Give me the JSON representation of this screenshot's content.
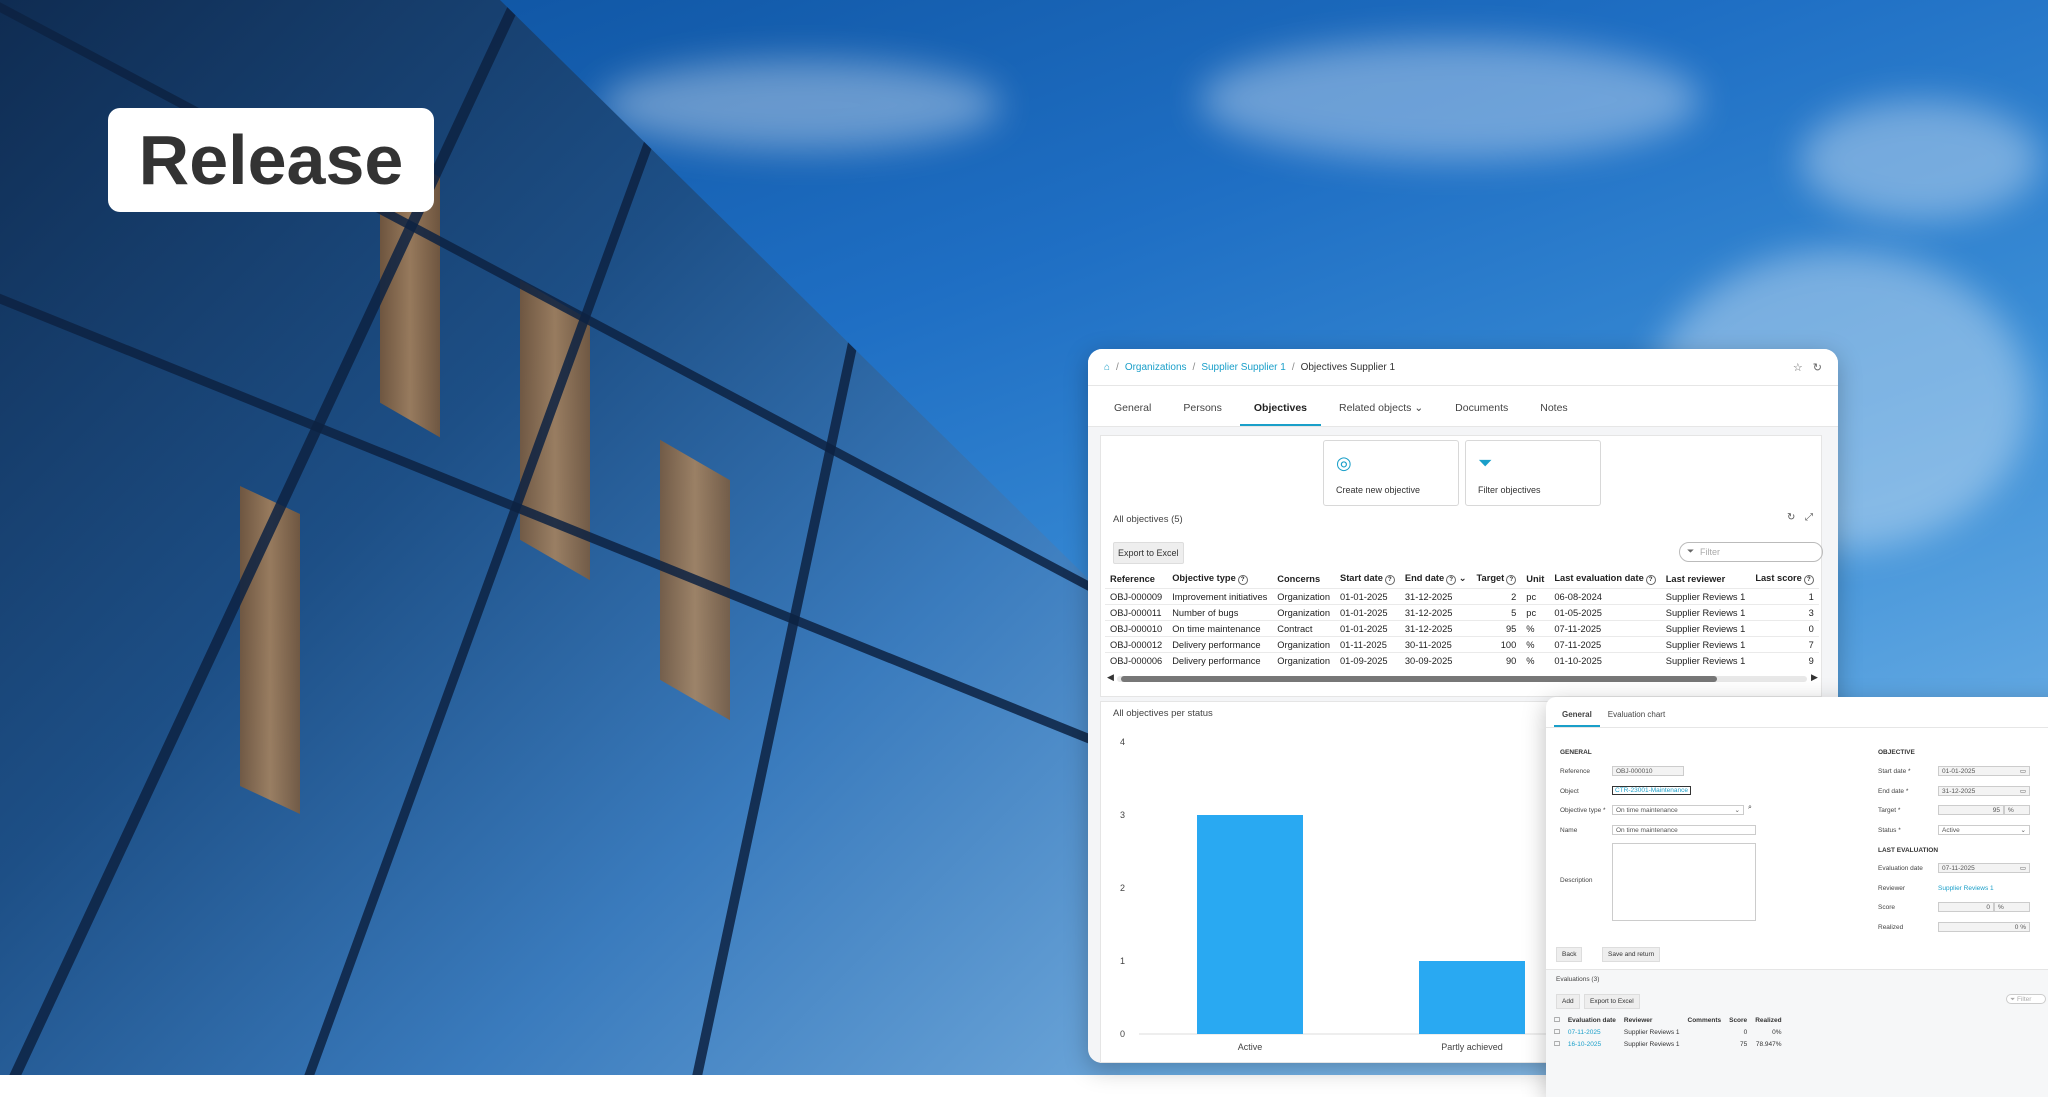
{
  "banner": {
    "label": "Release"
  },
  "breadcrumb": {
    "items": [
      "Organizations",
      "Supplier Supplier 1",
      "Objectives Supplier 1"
    ]
  },
  "tabs": [
    "General",
    "Persons",
    "Objectives",
    "Related objects",
    "Documents",
    "Notes"
  ],
  "active_tab": "Objectives",
  "actions": {
    "create_label": "Create new objective",
    "filter_label": "Filter objectives"
  },
  "objectives_section": {
    "title": "All objectives (5)",
    "export_label": "Export to Excel",
    "filter_placeholder": "Filter",
    "columns": [
      "Reference",
      "Objective type",
      "Concerns",
      "Start date",
      "End date",
      "Target",
      "Unit",
      "Last evaluation date",
      "Last reviewer",
      "Last score"
    ],
    "rows": [
      {
        "ref": "OBJ-000009",
        "type": "Improvement initiatives",
        "concerns": "Organization",
        "start": "01-01-2025",
        "end": "31-12-2025",
        "target": "2",
        "unit": "pc",
        "last_eval": "06-08-2024",
        "reviewer": "Supplier Reviews 1",
        "score": "1"
      },
      {
        "ref": "OBJ-000011",
        "type": "Number of bugs",
        "concerns": "Organization",
        "start": "01-01-2025",
        "end": "31-12-2025",
        "target": "5",
        "unit": "pc",
        "last_eval": "01-05-2025",
        "reviewer": "Supplier Reviews 1",
        "score": "3"
      },
      {
        "ref": "OBJ-000010",
        "type": "On time maintenance",
        "concerns": "Contract",
        "start": "01-01-2025",
        "end": "31-12-2025",
        "target": "95",
        "unit": "%",
        "last_eval": "07-11-2025",
        "reviewer": "Supplier Reviews 1",
        "score": "0"
      },
      {
        "ref": "OBJ-000012",
        "type": "Delivery performance",
        "concerns": "Organization",
        "start": "01-11-2025",
        "end": "30-11-2025",
        "target": "100",
        "unit": "%",
        "last_eval": "07-11-2025",
        "reviewer": "Supplier Reviews 1",
        "score": "7"
      },
      {
        "ref": "OBJ-000006",
        "type": "Delivery performance",
        "concerns": "Organization",
        "start": "01-09-2025",
        "end": "30-09-2025",
        "target": "90",
        "unit": "%",
        "last_eval": "01-10-2025",
        "reviewer": "Supplier Reviews 1",
        "score": "9"
      }
    ]
  },
  "chart_section": {
    "title": "All objectives per status"
  },
  "chart_data": {
    "type": "bar",
    "categories": [
      "Active",
      "Partly achieved"
    ],
    "values": [
      3,
      1
    ],
    "title": "",
    "xlabel": "",
    "ylabel": "",
    "ylim": [
      0,
      4
    ],
    "yticks": [
      0,
      1,
      2,
      3,
      4
    ],
    "color": "#29a9f2",
    "grid": false
  },
  "detail": {
    "tabs": [
      "General",
      "Evaluation chart"
    ],
    "general_header": "GENERAL",
    "objective_header": "OBJECTIVE",
    "last_eval_header": "LAST EVALUATION",
    "fields": {
      "reference_label": "Reference",
      "reference_value": "OBJ-000010",
      "object_label": "Object",
      "object_value": "CTR-23001-Maintenance",
      "objtype_label": "Objective type *",
      "objtype_value": "On time maintenance",
      "name_label": "Name",
      "name_value": "On time maintenance",
      "description_label": "Description",
      "start_label": "Start date *",
      "start_value": "01-01-2025",
      "end_label": "End date *",
      "end_value": "31-12-2025",
      "target_label": "Target *",
      "target_value": "95",
      "target_unit": "%",
      "status_label": "Status *",
      "status_value": "Active",
      "evaldate_label": "Evaluation date",
      "evaldate_value": "07-11-2025",
      "reviewer_label": "Reviewer",
      "reviewer_value": "Supplier Reviews 1",
      "score_label": "Score",
      "score_value": "0",
      "score_unit": "%",
      "realized_label": "Realized",
      "realized_value": "0 %"
    },
    "back_label": "Back",
    "save_label": "Save and return",
    "evaluations_title": "Evaluations (3)",
    "add_label": "Add",
    "export_label": "Export to Excel",
    "filter_placeholder": "Filter",
    "eval_columns": [
      "Evaluation date",
      "Reviewer",
      "Comments",
      "Score",
      "Realized"
    ],
    "eval_rows": [
      {
        "date": "07-11-2025",
        "reviewer": "Supplier Reviews 1",
        "comments": "",
        "score": "0",
        "realized": "0%"
      },
      {
        "date": "16-10-2025",
        "reviewer": "Supplier Reviews 1",
        "comments": "",
        "score": "75",
        "realized": "78.947%"
      }
    ]
  }
}
